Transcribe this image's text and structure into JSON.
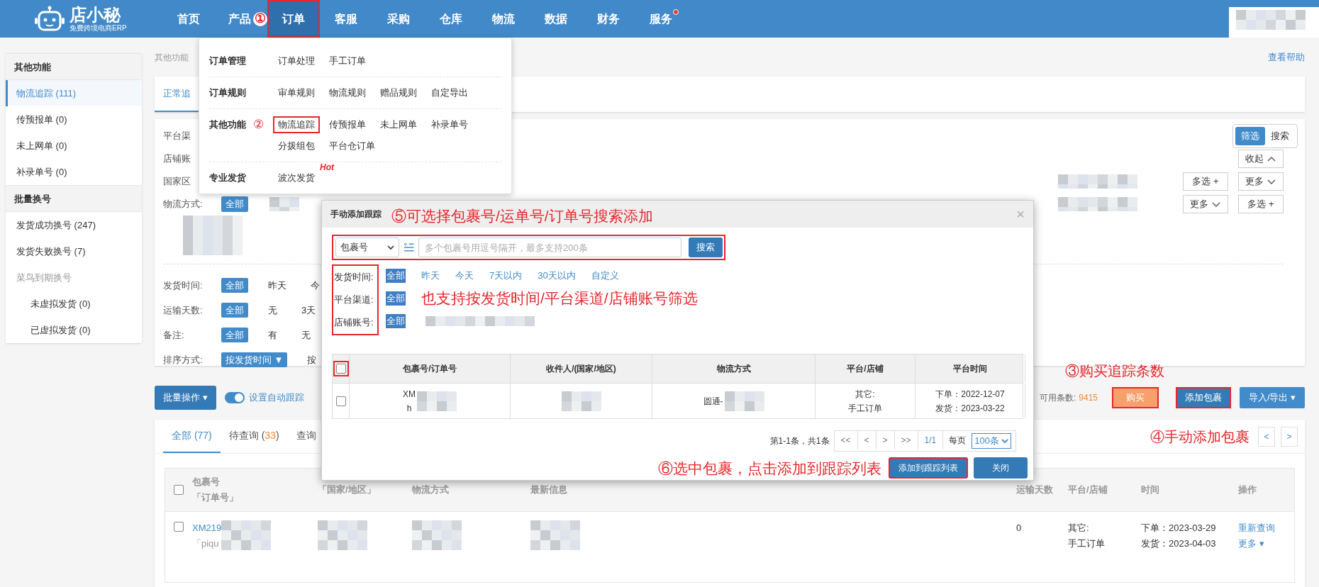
{
  "header": {
    "logo": {
      "title": "店小秘",
      "subtitle": "免费跨境电商ERP"
    },
    "nav": [
      {
        "label": "首页",
        "selected": false,
        "outlined": false,
        "dot": false
      },
      {
        "label": "产品",
        "selected": false,
        "outlined": false,
        "dot": false,
        "note": "①"
      },
      {
        "label": "订单",
        "selected": true,
        "outlined": true,
        "dot": false
      },
      {
        "label": "客服",
        "selected": false,
        "outlined": false,
        "dot": false
      },
      {
        "label": "采购",
        "selected": false,
        "outlined": false,
        "dot": false
      },
      {
        "label": "仓库",
        "selected": false,
        "outlined": false,
        "dot": false
      },
      {
        "label": "物流",
        "selected": false,
        "outlined": false,
        "dot": false
      },
      {
        "label": "数据",
        "selected": false,
        "outlined": false,
        "dot": false
      },
      {
        "label": "财务",
        "selected": false,
        "outlined": false,
        "dot": false
      },
      {
        "label": "服务",
        "selected": false,
        "outlined": false,
        "dot": true
      }
    ]
  },
  "order_menu": [
    {
      "title": "订单管理",
      "links": [
        {
          "label": "订单处理",
          "outlined": false
        },
        {
          "label": "手工订单",
          "outlined": false
        }
      ]
    },
    {
      "title": "订单规则",
      "links": [
        {
          "label": "审单规则",
          "outlined": false
        },
        {
          "label": "物流规则",
          "outlined": false
        },
        {
          "label": "赠品规则",
          "outlined": false
        },
        {
          "label": "自定导出",
          "outlined": false
        }
      ]
    },
    {
      "title": "其他功能",
      "note": "②",
      "links": [
        {
          "label": "物流追踪",
          "outlined": true
        },
        {
          "label": "传预报单",
          "outlined": false
        },
        {
          "label": "未上网单",
          "outlined": false
        },
        {
          "label": "补录单号",
          "outlined": false
        },
        {
          "label": "分拨组包",
          "outlined": false
        },
        {
          "label": "平台仓订单",
          "outlined": false
        }
      ]
    },
    {
      "title": "专业发货",
      "links": [
        {
          "label": "波次发货",
          "outlined": false,
          "badge": "Hot"
        }
      ]
    }
  ],
  "sidebar": [
    {
      "title": "其他功能",
      "items": [
        {
          "label": "物流追踪 (111)",
          "selected": true
        },
        {
          "label": "传预报单 (0)",
          "selected": false
        },
        {
          "label": "未上网单 (0)",
          "selected": false
        },
        {
          "label": "补录单号 (0)",
          "selected": false
        }
      ]
    },
    {
      "title": "批量换号",
      "items": [
        {
          "label": "发货成功换号 (247)",
          "selected": false
        },
        {
          "label": "发货失败换号 (7)",
          "selected": false
        },
        {
          "label": "菜鸟到期换号",
          "selected": false,
          "children": [
            {
              "label": "未虚拟发货 (0)",
              "selected": false
            },
            {
              "label": "已虚拟发货 (0)",
              "selected": false
            }
          ]
        }
      ]
    }
  ],
  "breadcrumb": "其他功能",
  "help_link": "查看帮助",
  "view_tabs": [
    {
      "label": "正常追",
      "selected": true
    }
  ],
  "filter_panel": {
    "mode": [
      {
        "label": "筛选",
        "selected": true
      },
      {
        "label": "搜索",
        "selected": false
      }
    ],
    "rows": [
      {
        "kind": "filter",
        "label": "平台渠"
      },
      {
        "kind": "filter",
        "label": "店铺账",
        "buttons": [
          {
            "label": "收起",
            "kind": "collapse"
          }
        ]
      },
      {
        "kind": "filter",
        "label": "国家区",
        "redacted": true,
        "buttons": [
          {
            "label": "多选 +",
            "kind": "multi"
          },
          {
            "label": "更多",
            "kind": "expand"
          }
        ]
      },
      {
        "kind": "filter",
        "label": "物流方式:",
        "options": [
          {
            "label": "全部",
            "selected": true
          }
        ],
        "redacted": true,
        "buttons": [
          {
            "label": "更多",
            "kind": "expand"
          },
          {
            "label": "多选 +",
            "kind": "multi"
          }
        ]
      },
      {
        "kind": "divider"
      },
      {
        "kind": "filter",
        "label": "发货时间:",
        "options": [
          {
            "label": "全部",
            "selected": true
          },
          {
            "label": "昨天",
            "selected": false
          },
          {
            "label": "今",
            "selected": false
          }
        ]
      },
      {
        "kind": "filter",
        "label": "运输天数:",
        "options": [
          {
            "label": "全部",
            "selected": true
          },
          {
            "label": "无",
            "selected": false
          },
          {
            "label": "3天",
            "selected": false
          }
        ]
      },
      {
        "kind": "filter",
        "label": "备注:",
        "options": [
          {
            "label": "全部",
            "selected": true
          },
          {
            "label": "有",
            "selected": false
          },
          {
            "label": "无",
            "selected": false
          }
        ]
      },
      {
        "kind": "filter",
        "label": "排序方式:",
        "options": [
          {
            "label": "按发货时间 ▼",
            "selected": true
          },
          {
            "label": "按",
            "selected": false
          }
        ]
      }
    ]
  },
  "actions": {
    "batch": "批量操作 ▾",
    "auto_track": {
      "label": "设置自动跟踪",
      "on": true
    },
    "quota_label": "可用条数:",
    "quota": "9415",
    "note": "③购买追踪条数",
    "buy": {
      "label": "购买",
      "outlined": true
    },
    "add": {
      "label": "添加包裹",
      "outlined": true
    },
    "import_export": "导入/导出 ▾"
  },
  "results": {
    "tabs": [
      {
        "label": "全部 (77)",
        "selected": true
      },
      {
        "label": "待查询 (",
        "count": "33",
        "tail": ")",
        "color": "#f0883a",
        "selected": false
      },
      {
        "label": "查询",
        "selected": false
      }
    ],
    "note": "④手动添加包裹",
    "pager": [
      "<",
      ">"
    ],
    "select_all": {
      "checked": false
    },
    "columns": [
      {
        "lines": [
          "包裹号",
          "「订单号」"
        ]
      },
      {
        "lines": [
          "「国家/地区」"
        ]
      },
      {
        "lines": [
          "物流方式"
        ]
      },
      {
        "lines": [
          "最新信息"
        ]
      },
      {
        "lines": [
          "运输天数"
        ]
      },
      {
        "lines": [
          "平台/店铺"
        ]
      },
      {
        "lines": [
          "时间"
        ]
      },
      {
        "lines": [
          "操作"
        ]
      }
    ],
    "rows": [
      {
        "checked": false,
        "cells": [
          {
            "kind": "id",
            "lines": [
              "XM219",
              "「piqu"
            ],
            "redacted": true
          },
          {
            "redacted": true
          },
          {
            "redacted": true
          },
          {
            "redacted": true
          },
          {
            "kind": "text",
            "lines": [
              "0"
            ]
          },
          {
            "kind": "text",
            "lines": [
              "其它:",
              "手工订单"
            ]
          },
          {
            "kind": "text",
            "lines": [
              "下单：2023-03-29",
              "发货：2023-04-03"
            ]
          },
          {
            "kind": "links",
            "lines": [
              "重新查询",
              "更多 ▾"
            ]
          }
        ]
      }
    ]
  },
  "modal": {
    "title": "手动添加跟踪",
    "note": "⑤可选择包裹号/运单号/订单号搜索添加",
    "close": "×",
    "search": {
      "outlined": true,
      "field_type": "包裹号",
      "placeholder": "多个包裹号用逗号隔开，最多支持200条",
      "button": "搜索"
    },
    "filters": {
      "outlined": true,
      "rows": [
        {
          "label": "发货时间:",
          "options": [
            {
              "label": "全部",
              "selected": true
            },
            {
              "label": "昨天",
              "selected": false
            },
            {
              "label": "今天",
              "selected": false
            },
            {
              "label": "7天以内",
              "selected": false
            },
            {
              "label": "30天以内",
              "selected": false
            },
            {
              "label": "自定义",
              "selected": false
            }
          ]
        },
        {
          "label": "平台渠道:",
          "options": [
            {
              "label": "全部",
              "selected": true
            }
          ],
          "note": "也支持按发货时间/平台渠道/店铺账号筛选"
        },
        {
          "label": "店铺账号:",
          "options": [
            {
              "label": "全部",
              "selected": true
            }
          ],
          "redacted": true
        }
      ]
    },
    "table": {
      "select_all": {
        "checked": false,
        "outlined": true
      },
      "columns": [
        "包裹号/订单号",
        "收件人/(国家/地区)",
        "物流方式",
        "平台/店铺",
        "平台时间"
      ],
      "rows": [
        {
          "checked": false,
          "cells": [
            {
              "lines": [
                "XM",
                "h"
              ],
              "redacted": true
            },
            {
              "redacted": true
            },
            {
              "lines": [
                "圆通-"
              ],
              "redacted": true
            },
            {
              "lines": [
                "其它:",
                "手工订单"
              ]
            },
            {
              "lines": [
                "下单：2022-12-07",
                "发货：2023-03-22"
              ]
            }
          ]
        }
      ]
    },
    "pagination": {
      "summary": "第1-1条，共1条",
      "buttons": [
        "<<",
        "<",
        ">",
        ">>"
      ],
      "page": "1/1",
      "per_page_label": "每页",
      "per_page": "100条"
    },
    "footer_note": "⑥选中包裹，点击添加到跟踪列表",
    "buttons": [
      {
        "label": "添加到跟踪列表",
        "outlined": true
      },
      {
        "label": "关闭",
        "outlined": false
      }
    ]
  }
}
